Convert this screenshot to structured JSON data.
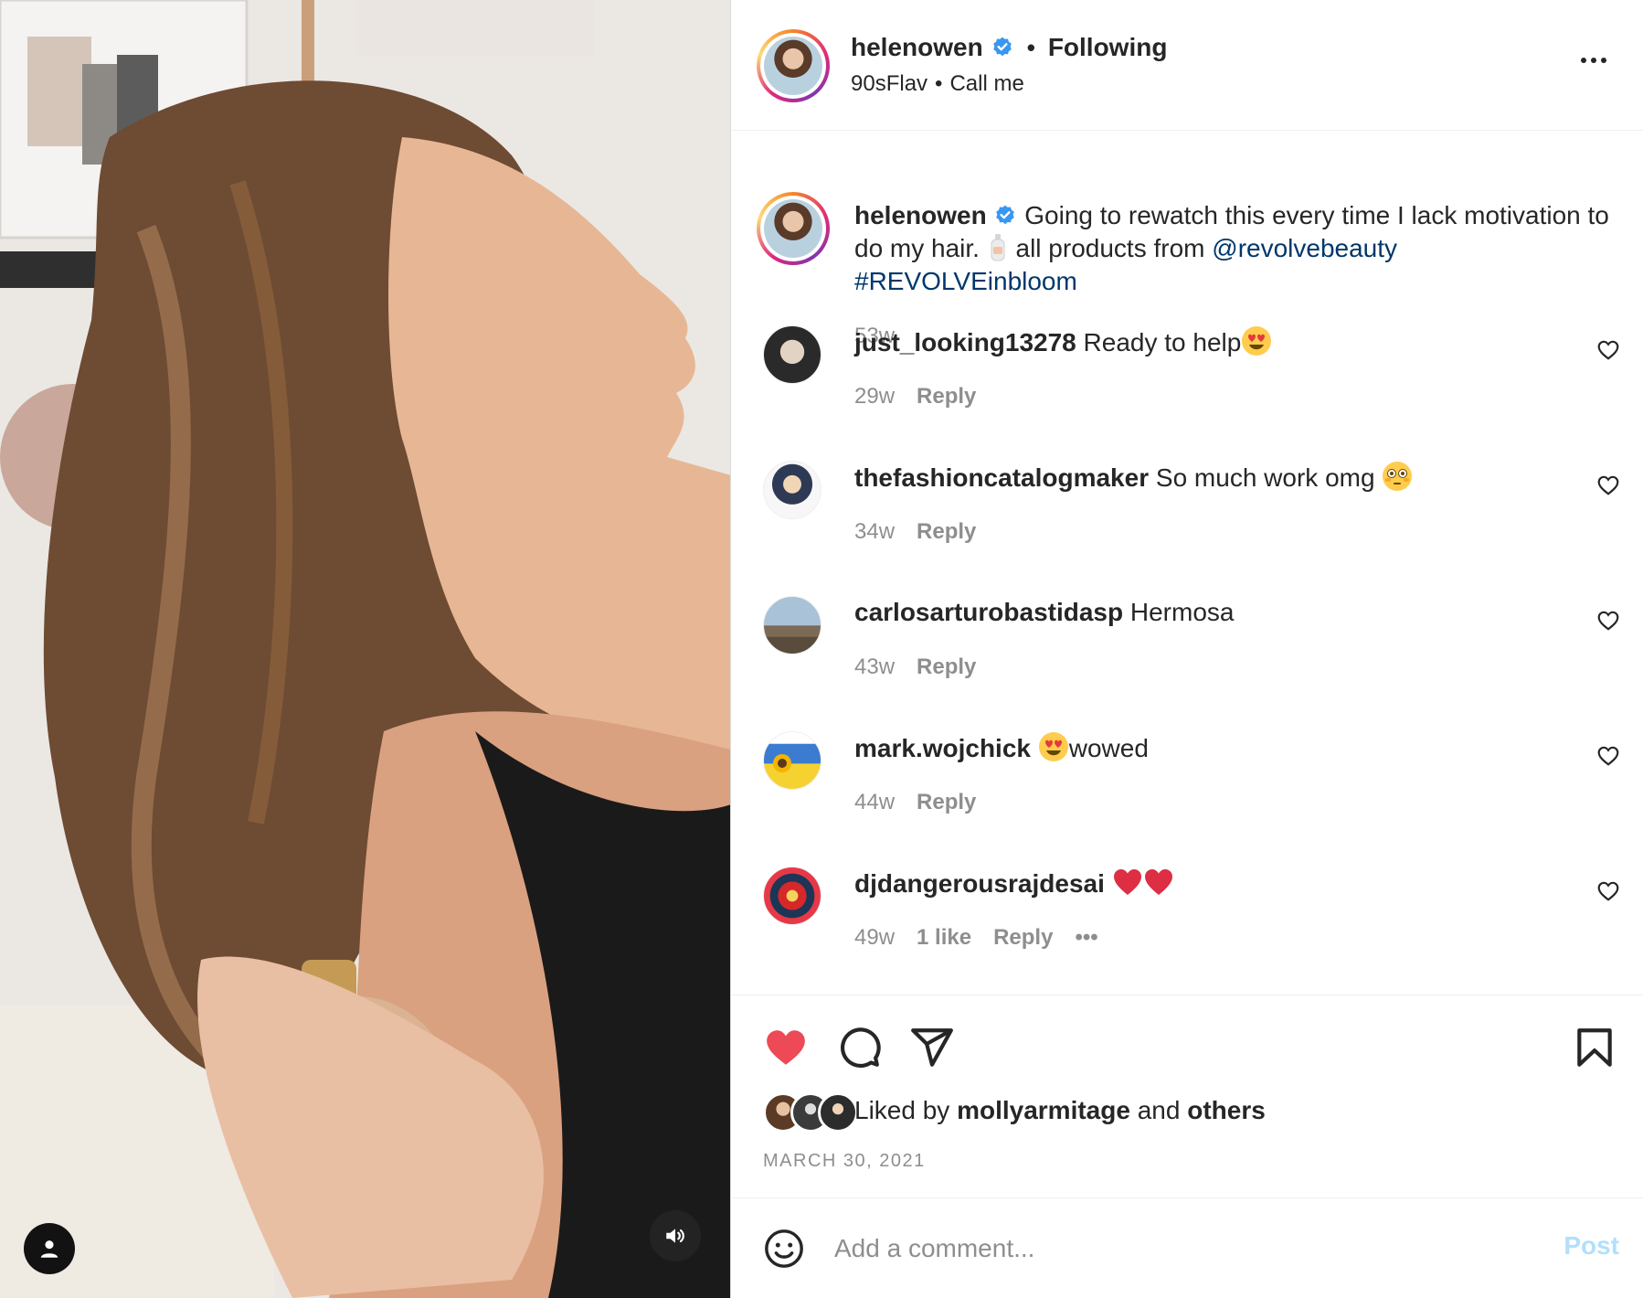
{
  "header": {
    "username": "helenowen",
    "separator": "•",
    "follow_status": "Following",
    "audio_artist": "90sFlav",
    "audio_separator": "•",
    "audio_title": "Call me"
  },
  "caption": {
    "username": "helenowen",
    "text_before": "Going to rewatch this every time I lack motivation to do my hair.",
    "text_after": "all products from",
    "mention": "@revolvebeauty",
    "hashtag": "#REVOLVEinbloom",
    "time": "53w"
  },
  "comments": [
    {
      "username": "just_looking13278",
      "text": "Ready to help",
      "emoji": "heart-eyes-emoji",
      "time": "29w",
      "reply": "Reply"
    },
    {
      "username": "thefashioncatalogmaker",
      "text": "So much work omg",
      "emoji": "flushed-emoji",
      "time": "34w",
      "reply": "Reply"
    },
    {
      "username": "carlosarturobastidasp",
      "text": "Hermosa",
      "time": "43w",
      "reply": "Reply"
    },
    {
      "username": "mark.wojchick",
      "text": "wowed",
      "emoji": "heart-eyes-emoji",
      "time": "44w",
      "reply": "Reply"
    },
    {
      "username": "djdangerousrajdesai",
      "text": "",
      "emoji": "red-heart-emoji",
      "time": "49w",
      "likes": "1 like",
      "reply": "Reply"
    }
  ],
  "actions": {
    "liked_prefix": "Liked by",
    "liked_user": "mollyarmitage",
    "liked_and": "and",
    "liked_others": "others",
    "date": "MARCH 30, 2021"
  },
  "add_comment": {
    "placeholder": "Add a comment...",
    "post_label": "Post"
  },
  "colors": {
    "like_red": "#ed4956",
    "verified_blue": "#3897f0",
    "link_blue": "#00376b",
    "post_disabled": "#b2dffc"
  }
}
